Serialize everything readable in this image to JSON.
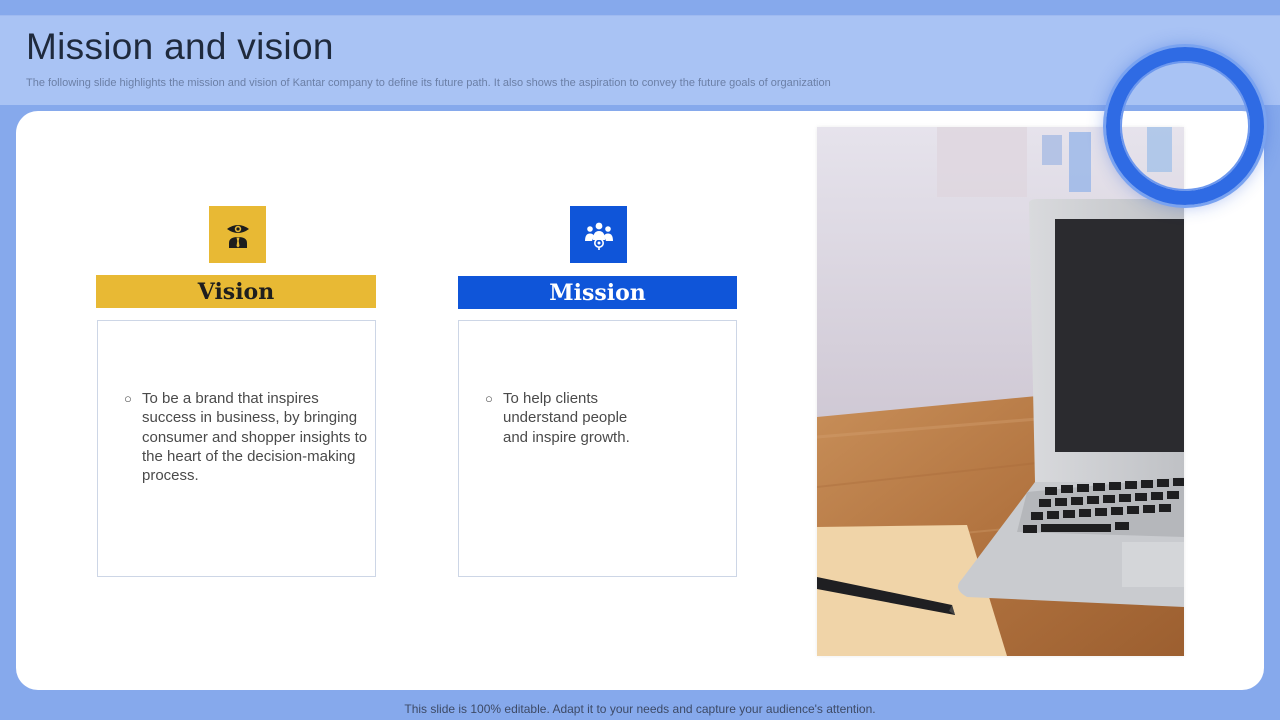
{
  "slide": {
    "title": "Mission and vision",
    "subtitle": "The following slide highlights the mission and vision of Kantar company to  define its future  path. It also shows the aspiration to convey the future  goals of organization"
  },
  "vision": {
    "heading": "Vision",
    "icon": "eye-person-icon",
    "bullet_symbol": "○",
    "points": [
      "To be a brand that inspires success in business, by bringing consumer and shopper insights to the heart of the decision-making process."
    ]
  },
  "mission": {
    "heading": "Mission",
    "icon": "team-target-icon",
    "bullet_symbol": "○",
    "points": [
      "To help clients understand people and inspire growth."
    ]
  },
  "footer": {
    "note": "This slide is 100% editable. Adapt it to your needs and capture your audience's attention."
  },
  "colors": {
    "background": "#86a9ec",
    "vision_accent": "#e8b934",
    "mission_accent": "#0f55d9",
    "ring": "#2f6be4"
  }
}
